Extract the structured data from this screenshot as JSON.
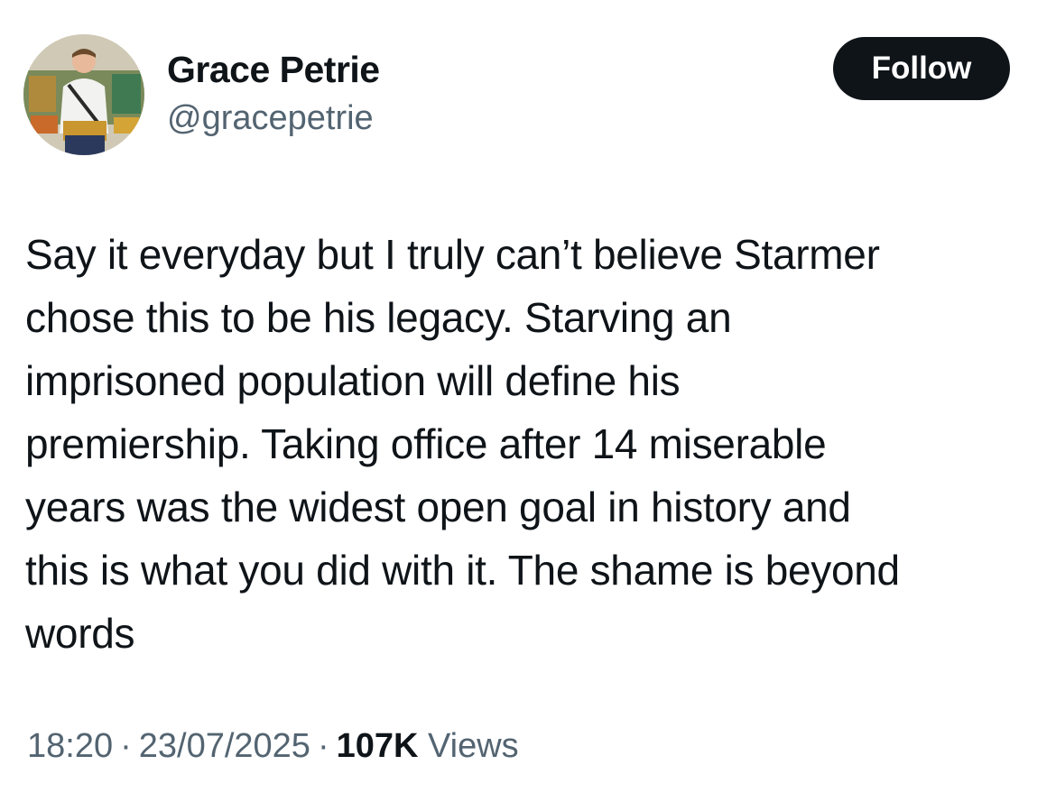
{
  "author": {
    "display_name": "Grace Petrie",
    "handle": "@gracepetrie",
    "avatar_icon": "profile-photo"
  },
  "follow_button": {
    "label": "Follow"
  },
  "tweet": {
    "lines": [
      "Say it everyday but I truly can’t believe Starmer",
      "chose this to be his legacy. Starving an",
      "imprisoned population will define his",
      "premiership. Taking office after 14 miserable",
      "years was the widest open goal in history and",
      "this is what you did with it. The shame is beyond",
      "words"
    ]
  },
  "meta": {
    "time": "18:20",
    "separator": "·",
    "date": "23/07/2025",
    "views_count": "107K",
    "views_label": "Views"
  },
  "colors": {
    "text_primary": "#0f1419",
    "text_secondary": "#536471",
    "button_bg": "#0f1419",
    "button_text": "#ffffff"
  }
}
